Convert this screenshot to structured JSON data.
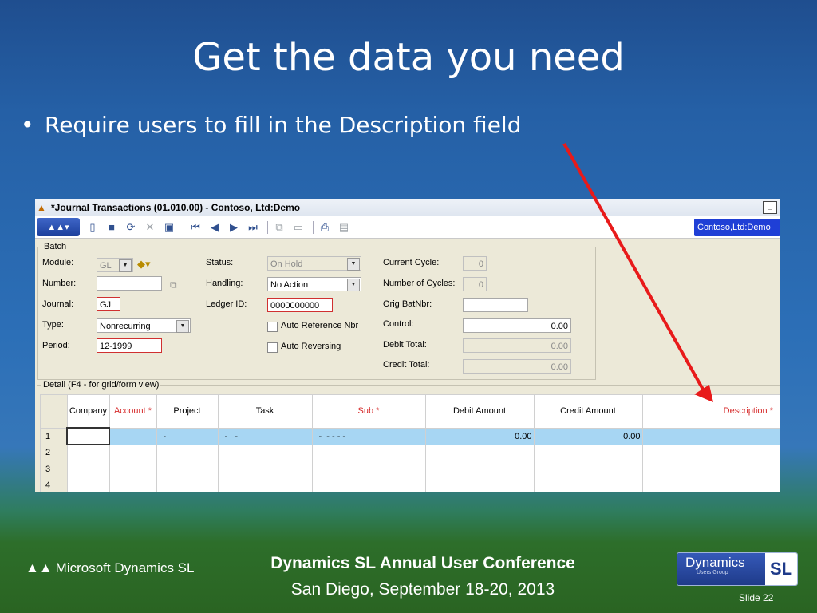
{
  "slide": {
    "title": "Get the data you need",
    "bullet_symbol": "•",
    "bullet": "Require users to fill in the Description field",
    "footer_logo": "Microsoft Dynamics SL",
    "conference_title": "Dynamics SL Annual User Conference",
    "conference_sub": "San Diego, September 18-20, 2013",
    "badge_main": "Dynamics",
    "badge_small": "Users Group",
    "badge_sl": "SL",
    "slide_number": "Slide 22",
    "arrow_color": "#e81a1a"
  },
  "window": {
    "title": "*Journal Transactions (01.010.00) - Contoso, Ltd:Demo",
    "minimize_icon": "minimize-icon",
    "company_chip": "Contoso,Ltd:Demo",
    "toolbar_icons": [
      "new-icon",
      "save-icon",
      "refresh-icon",
      "delete-icon",
      "cancel-icon",
      "first-icon",
      "prev-icon",
      "next-icon",
      "last-icon",
      "copy-icon",
      "paste-icon",
      "print-icon",
      "report-icon"
    ]
  },
  "batch": {
    "legend": "Batch",
    "module_label": "Module:",
    "module_value": "GL",
    "number_label": "Number:",
    "number_value": "",
    "journal_label": "Journal:",
    "journal_value": "GJ",
    "type_label": "Type:",
    "type_value": "Nonrecurring",
    "period_label": "Period:",
    "period_value": "12-1999",
    "status_label": "Status:",
    "status_value": "On Hold",
    "handling_label": "Handling:",
    "handling_value": "No Action",
    "ledger_label": "Ledger ID:",
    "ledger_value": "0000000000",
    "auto_ref_label": "Auto Reference Nbr",
    "auto_rev_label": "Auto Reversing",
    "cycle_label": "Current Cycle:",
    "cycle_value": "0",
    "num_cycles_label": "Number of Cycles:",
    "num_cycles_value": "0",
    "orig_label": "Orig BatNbr:",
    "orig_value": "",
    "control_label": "Control:",
    "control_value": "0.00",
    "debit_label": "Debit Total:",
    "debit_value": "0.00",
    "credit_label": "Credit Total:",
    "credit_value": "0.00"
  },
  "detail": {
    "legend": "Detail (F4 - for grid/form view)",
    "columns": [
      "Company",
      "Account *",
      "Project",
      "Task",
      "Sub *",
      "Debit Amount",
      "Credit Amount",
      "Description *"
    ],
    "rows": [
      {
        "num": "1",
        "company": "",
        "account": "",
        "project": "-",
        "task": "-   -",
        "sub": "-  - - - -",
        "debit": "0.00",
        "credit": "0.00",
        "description": ""
      },
      {
        "num": "2",
        "company": "",
        "account": "",
        "project": "",
        "task": "",
        "sub": "",
        "debit": "",
        "credit": "",
        "description": ""
      },
      {
        "num": "3",
        "company": "",
        "account": "",
        "project": "",
        "task": "",
        "sub": "",
        "debit": "",
        "credit": "",
        "description": ""
      },
      {
        "num": "4",
        "company": "",
        "account": "",
        "project": "",
        "task": "",
        "sub": "",
        "debit": "",
        "credit": "",
        "description": ""
      }
    ]
  }
}
